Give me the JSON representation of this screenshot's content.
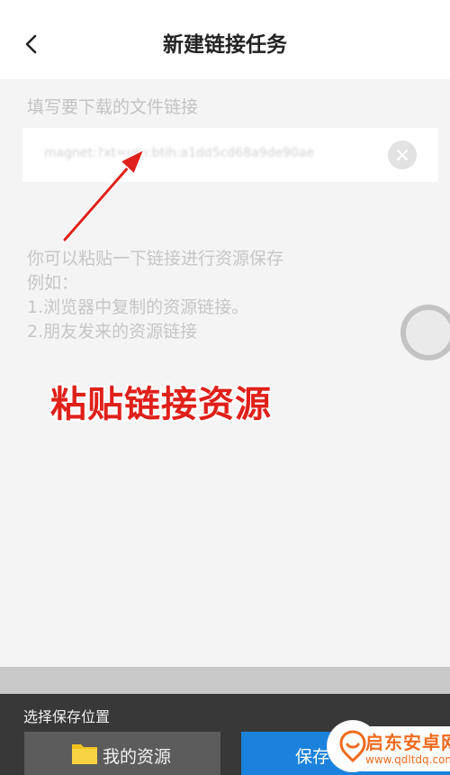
{
  "header": {
    "title": "新建链接任务",
    "back_icon": "chevron-left-icon"
  },
  "form": {
    "field_label": "填写要下载的文件链接",
    "link_value": "magnet:?xt=urn:btih:a1dd5cd68a9de90ae",
    "clear_icon": "clear-circle-icon"
  },
  "tips": {
    "line1": "你可以粘贴一下链接进行资源保存",
    "line2": "例如：",
    "line3": "1.浏览器中复制的资源链接。",
    "line4": "2.朋友发来的资源链接"
  },
  "annotation": {
    "text": "粘贴链接资源",
    "color": "#e0201a"
  },
  "bottom": {
    "save_location_label": "选择保存位置",
    "my_resources_label": "我的资源",
    "folder_icon": "folder-icon",
    "save_button_label": "保存"
  },
  "watermark": {
    "name": "启东安卓网",
    "url": "www.qdltdq.com"
  },
  "colors": {
    "accent": "#1a82dc",
    "bottom_bar": "#383838",
    "background": "#f4f4f4"
  }
}
